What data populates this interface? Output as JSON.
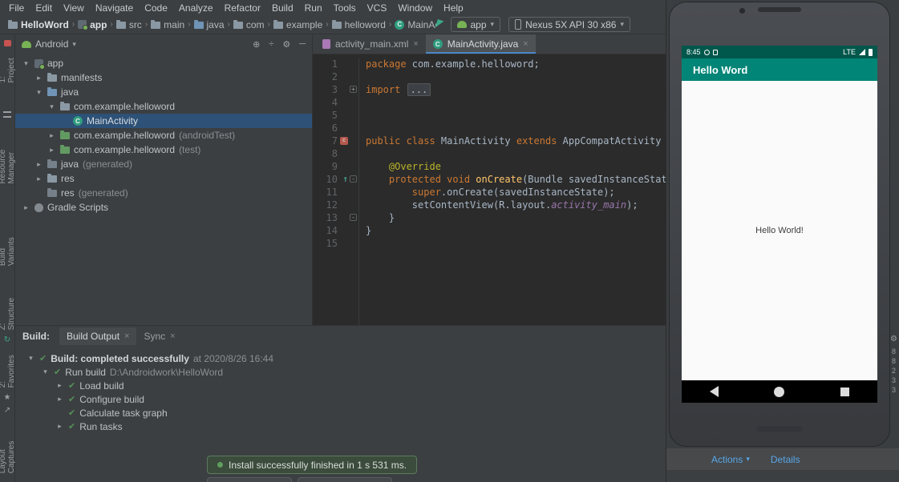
{
  "menu": {
    "items": [
      "File",
      "Edit",
      "View",
      "Navigate",
      "Code",
      "Analyze",
      "Refactor",
      "Build",
      "Run",
      "Tools",
      "VCS",
      "Window",
      "Help"
    ]
  },
  "breadcrumbs": {
    "items": [
      {
        "label": "HelloWord",
        "icon": "folder",
        "bold": true
      },
      {
        "label": "app",
        "icon": "module",
        "bold": true
      },
      {
        "label": "src",
        "icon": "folder",
        "bold": false
      },
      {
        "label": "main",
        "icon": "folder",
        "bold": false
      },
      {
        "label": "java",
        "icon": "folder-java",
        "bold": false
      },
      {
        "label": "com",
        "icon": "folder",
        "bold": false
      },
      {
        "label": "example",
        "icon": "folder",
        "bold": false
      },
      {
        "label": "helloword",
        "icon": "folder",
        "bold": false
      },
      {
        "label": "MainActivity",
        "icon": "class",
        "bold": false
      }
    ]
  },
  "toolbar": {
    "module_selector": "app",
    "device_selector": "Nexus 5X API 30 x86"
  },
  "tool_strip": {
    "labels": [
      "1: Project",
      "Resource Manager",
      "Build Variants",
      "Z: Structure",
      "2: Favorites",
      "Layout Captures"
    ]
  },
  "project_panel": {
    "view_selector": "Android",
    "actions": [
      "locate",
      "collapse",
      "settings",
      "hide"
    ],
    "tree": [
      {
        "level": 0,
        "arrow": "down",
        "icon": "module",
        "label": "app",
        "suffix": "",
        "selected": false
      },
      {
        "level": 1,
        "arrow": "right",
        "icon": "folder",
        "label": "manifests",
        "suffix": "",
        "selected": false
      },
      {
        "level": 1,
        "arrow": "down",
        "icon": "folder-java",
        "label": "java",
        "suffix": "",
        "selected": false
      },
      {
        "level": 2,
        "arrow": "down",
        "icon": "folder",
        "label": "com.example.helloword",
        "suffix": "",
        "selected": false
      },
      {
        "level": 3,
        "arrow": "none",
        "icon": "class",
        "label": "MainActivity",
        "suffix": "",
        "selected": true
      },
      {
        "level": 2,
        "arrow": "right",
        "icon": "folder-test",
        "label": "com.example.helloword",
        "suffix": " (androidTest)",
        "selected": false
      },
      {
        "level": 2,
        "arrow": "right",
        "icon": "folder-test",
        "label": "com.example.helloword",
        "suffix": " (test)",
        "selected": false
      },
      {
        "level": 1,
        "arrow": "right",
        "icon": "folder-gen",
        "label": "java",
        "suffix": " (generated)",
        "selected": false
      },
      {
        "level": 1,
        "arrow": "right",
        "icon": "folder",
        "label": "res",
        "suffix": "",
        "selected": false
      },
      {
        "level": 1,
        "arrow": "none",
        "icon": "folder-gen",
        "label": "res",
        "suffix": " (generated)",
        "selected": false
      },
      {
        "level": 0,
        "arrow": "right",
        "icon": "gradle",
        "label": "Gradle Scripts",
        "suffix": "",
        "selected": false
      }
    ]
  },
  "editor": {
    "tabs": [
      {
        "label": "activity_main.xml",
        "icon": "layout",
        "active": false
      },
      {
        "label": "MainActivity.java",
        "icon": "class",
        "active": true
      }
    ],
    "lines": [
      {
        "num": 1,
        "segments": [
          {
            "t": "package ",
            "c": "kw"
          },
          {
            "t": "com.example.helloword;",
            "c": "pl"
          }
        ]
      },
      {
        "num": 2,
        "segments": []
      },
      {
        "num": 3,
        "segments": [
          {
            "t": "import ",
            "c": "kw"
          },
          {
            "t": "...",
            "c": "fold"
          }
        ],
        "fold": "+"
      },
      {
        "num": 4,
        "segments": []
      },
      {
        "num": 5,
        "segments": []
      },
      {
        "num": 6,
        "segments": []
      },
      {
        "num": 7,
        "segments": [
          {
            "t": "public class ",
            "c": "kw"
          },
          {
            "t": "MainActivity ",
            "c": "pl"
          },
          {
            "t": "extends ",
            "c": "kw"
          },
          {
            "t": "AppCompatActivity {",
            "c": "pl"
          }
        ],
        "gutter": "class"
      },
      {
        "num": 8,
        "segments": []
      },
      {
        "num": 9,
        "segments": [
          {
            "t": "    ",
            "c": "pl"
          },
          {
            "t": "@Override",
            "c": "ann"
          }
        ]
      },
      {
        "num": 10,
        "segments": [
          {
            "t": "    ",
            "c": "pl"
          },
          {
            "t": "protected void ",
            "c": "kw"
          },
          {
            "t": "onCreate",
            "c": "mtd"
          },
          {
            "t": "(Bundle savedInstanceState) {",
            "c": "pl"
          }
        ],
        "gutter": "override",
        "fold": "-"
      },
      {
        "num": 11,
        "segments": [
          {
            "t": "        ",
            "c": "pl"
          },
          {
            "t": "super",
            "c": "kw"
          },
          {
            "t": ".onCreate(savedInstanceState);",
            "c": "pl"
          }
        ]
      },
      {
        "num": 12,
        "segments": [
          {
            "t": "        setContentView(R.layout.",
            "c": "pl"
          },
          {
            "t": "activity_main",
            "c": "fld"
          },
          {
            "t": ");",
            "c": "pl"
          }
        ]
      },
      {
        "num": 13,
        "segments": [
          {
            "t": "    }",
            "c": "pl"
          }
        ],
        "fold": "-"
      },
      {
        "num": 14,
        "segments": [
          {
            "t": "}",
            "c": "pl"
          }
        ]
      },
      {
        "num": 15,
        "segments": []
      }
    ]
  },
  "build_panel": {
    "label": "Build:",
    "tabs": [
      {
        "label": "Build Output",
        "active": true
      },
      {
        "label": "Sync",
        "active": false
      }
    ],
    "tree": [
      {
        "level": 0,
        "arrow": "down",
        "check": true,
        "segments": [
          {
            "t": "Build: completed successfully",
            "c": "b"
          },
          {
            "t": " at 2020/8/26 16:44",
            "c": "dim"
          }
        ]
      },
      {
        "level": 1,
        "arrow": "down",
        "check": true,
        "segments": [
          {
            "t": "Run build ",
            "c": "n"
          },
          {
            "t": "D:\\Androidwork\\HelloWord",
            "c": "dim"
          }
        ]
      },
      {
        "level": 2,
        "arrow": "right",
        "check": true,
        "segments": [
          {
            "t": "Load build",
            "c": "n"
          }
        ]
      },
      {
        "level": 2,
        "arrow": "right",
        "check": true,
        "segments": [
          {
            "t": "Configure build",
            "c": "n"
          }
        ]
      },
      {
        "level": 2,
        "arrow": "none",
        "check": true,
        "segments": [
          {
            "t": "Calculate task graph",
            "c": "n"
          }
        ]
      },
      {
        "level": 2,
        "arrow": "right",
        "check": true,
        "segments": [
          {
            "t": "Run tasks",
            "c": "n"
          }
        ]
      }
    ]
  },
  "toast": {
    "text": "Install successfully finished in 1 s 531 ms."
  },
  "emulator": {
    "status_bar": {
      "time": "8:45",
      "network": "LTE"
    },
    "app_bar_title": "Hello Word",
    "body_text": "Hello World!",
    "toolbar": {
      "actions": "Actions",
      "details": "Details"
    }
  },
  "right_strip": {
    "digits": [
      "8",
      "8",
      "2",
      "3",
      "3"
    ]
  },
  "colors": {
    "primary": "#008577",
    "primary_dark": "#00574B",
    "selection_blue": "#2d5177",
    "tab_accent": "#4a88c7",
    "keyword_orange": "#cc7832"
  }
}
